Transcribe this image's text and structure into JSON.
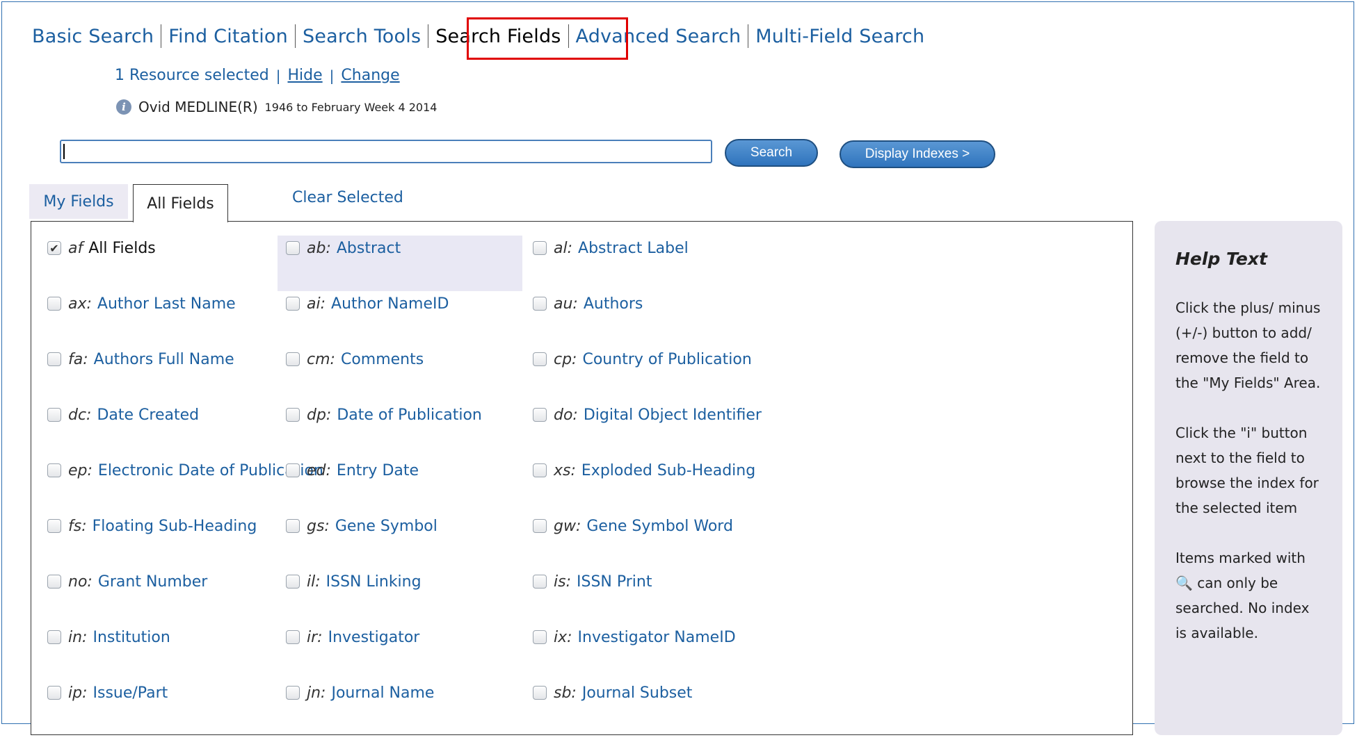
{
  "nav": {
    "items": [
      {
        "label": "Basic Search",
        "active": false
      },
      {
        "label": "Find Citation",
        "active": false
      },
      {
        "label": "Search Tools",
        "active": false
      },
      {
        "label": "Search Fields",
        "active": true
      },
      {
        "label": "Advanced Search",
        "active": false
      },
      {
        "label": "Multi-Field Search",
        "active": false
      }
    ]
  },
  "resources": {
    "selected_text": "1 Resource selected",
    "sep": "|",
    "hide_label": "Hide",
    "change_label": "Change",
    "db_name": "Ovid MEDLINE(R)",
    "db_range": "1946 to February Week 4 2014"
  },
  "search": {
    "query": "",
    "search_label": "Search",
    "display_indexes_label": "Display Indexes >"
  },
  "tabs": {
    "my_fields": "My Fields",
    "all_fields": "All Fields",
    "clear_selected": "Clear Selected"
  },
  "fields": [
    [
      {
        "code": "af",
        "label": "All Fields",
        "checked": true,
        "dark": true
      },
      {
        "code": "ab:",
        "label": "Abstract",
        "highlight": true
      },
      {
        "code": "al:",
        "label": "Abstract Label"
      }
    ],
    [
      {
        "code": "ax:",
        "label": "Author Last Name"
      },
      {
        "code": "ai:",
        "label": "Author NameID"
      },
      {
        "code": "au:",
        "label": "Authors"
      }
    ],
    [
      {
        "code": "fa:",
        "label": "Authors Full Name"
      },
      {
        "code": "cm:",
        "label": "Comments"
      },
      {
        "code": "cp:",
        "label": "Country of Publication"
      }
    ],
    [
      {
        "code": "dc:",
        "label": "Date Created"
      },
      {
        "code": "dp:",
        "label": "Date of Publication"
      },
      {
        "code": "do:",
        "label": "Digital Object Identifier"
      }
    ],
    [
      {
        "code": "ep:",
        "label": "Electronic Date of Publication"
      },
      {
        "code": "ed:",
        "label": "Entry Date"
      },
      {
        "code": "xs:",
        "label": "Exploded Sub-Heading"
      }
    ],
    [
      {
        "code": "fs:",
        "label": "Floating Sub-Heading"
      },
      {
        "code": "gs:",
        "label": "Gene Symbol"
      },
      {
        "code": "gw:",
        "label": "Gene Symbol Word"
      }
    ],
    [
      {
        "code": "no:",
        "label": "Grant Number"
      },
      {
        "code": "il:",
        "label": "ISSN Linking"
      },
      {
        "code": "is:",
        "label": "ISSN Print"
      }
    ],
    [
      {
        "code": "in:",
        "label": "Institution"
      },
      {
        "code": "ir:",
        "label": "Investigator"
      },
      {
        "code": "ix:",
        "label": "Investigator NameID"
      }
    ],
    [
      {
        "code": "ip:",
        "label": "Issue/Part"
      },
      {
        "code": "jn:",
        "label": "Journal Name"
      },
      {
        "code": "sb:",
        "label": "Journal Subset"
      }
    ]
  ],
  "help": {
    "title": "Help Text",
    "p1": "Click the plus/ minus (+/-) button to add/ remove the field to the \"My Fields\" Area.",
    "p2": "Click the \"i\" button next to the field to browse the index for the selected item",
    "p3_before": "Items marked with",
    "p3_icon": "magnifier-icon",
    "p3_after": "can only be searched. No index is available."
  },
  "colors": {
    "link": "#1c5fa0",
    "highlight_box": "#e00000",
    "button": "#2f74bd"
  }
}
